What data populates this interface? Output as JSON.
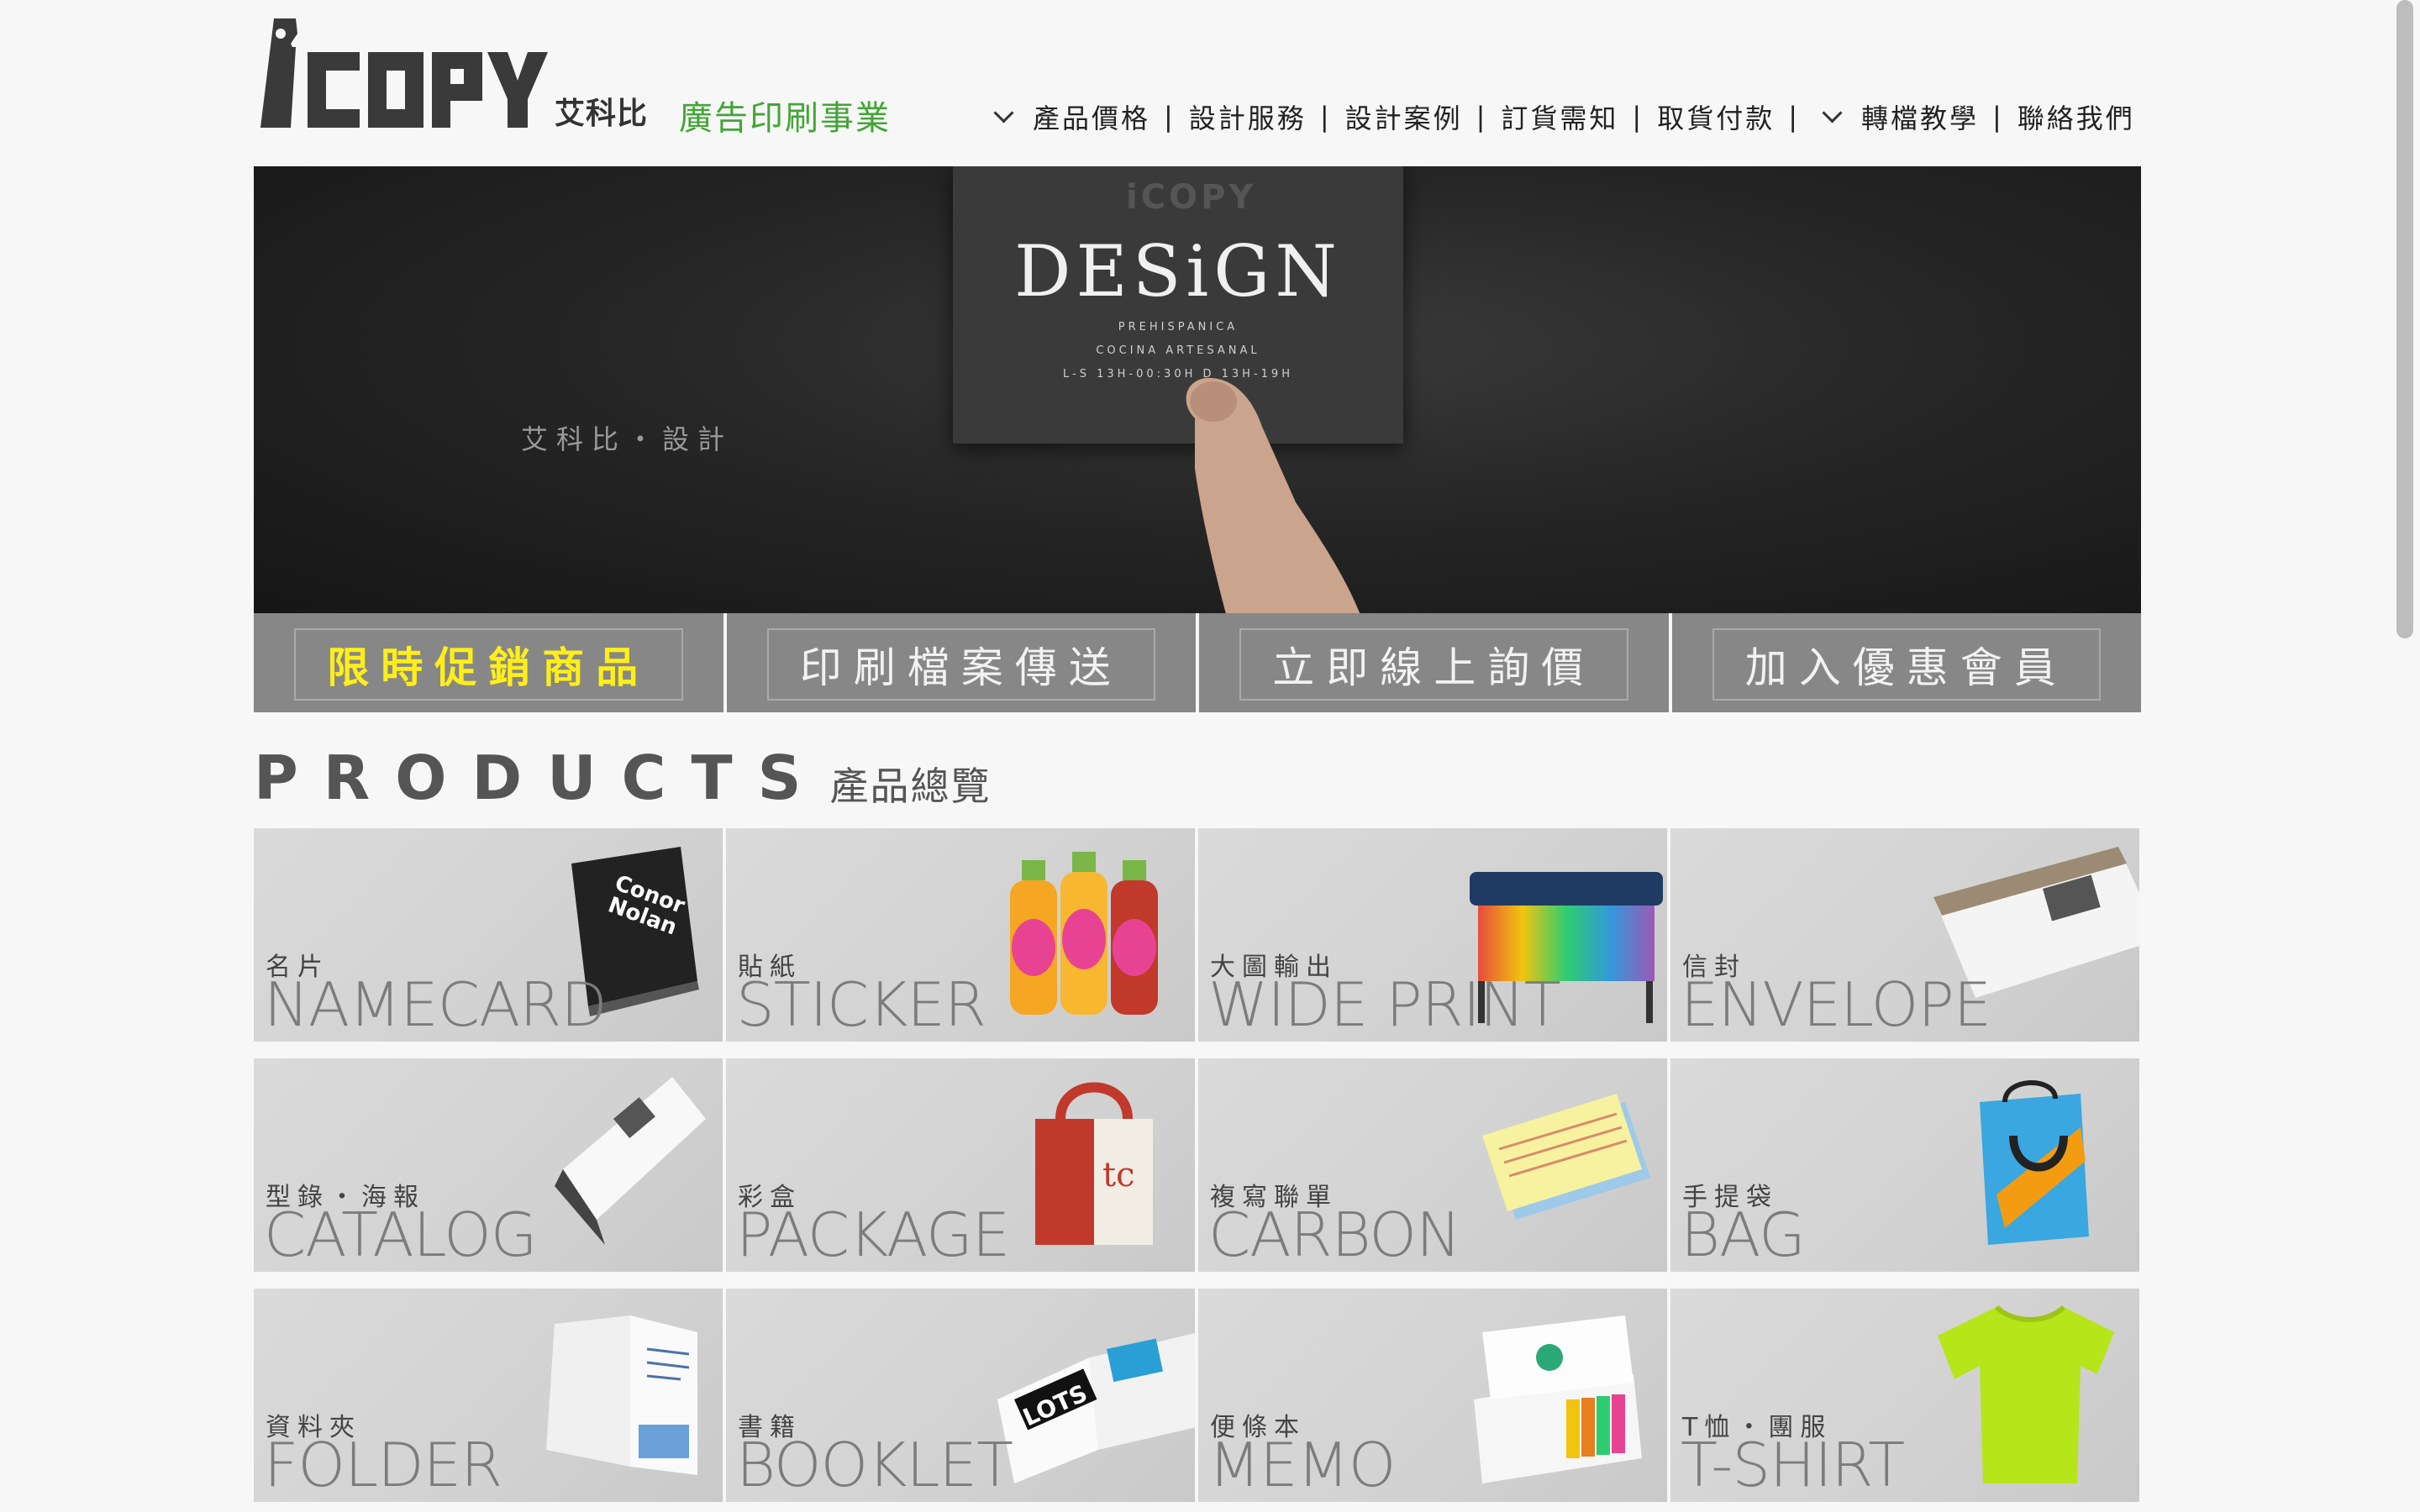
{
  "header": {
    "logo_text": "iCOPY",
    "logo_cn": "艾科比",
    "tagline": "廣告印刷事業"
  },
  "nav": {
    "items": [
      {
        "label": "產品價格",
        "dropdown": true
      },
      {
        "label": "設計服務"
      },
      {
        "label": "設計案例"
      },
      {
        "label": "訂貨需知"
      },
      {
        "label": "取貨付款"
      },
      {
        "label": "轉檔教學",
        "dropdown": true
      },
      {
        "label": "聯絡我們"
      }
    ],
    "separator": "|"
  },
  "banner": {
    "card_logo": "iCOPY",
    "card_title": "DESiGN",
    "card_line1": "PREHISPANICA",
    "card_line2": "COCINA ARTESANAL",
    "card_line3": "L-S 13H-00:30H D 13H-19H",
    "caption": "艾科比・設計"
  },
  "quick_buttons": [
    {
      "label": "限時促銷商品",
      "highlight": true
    },
    {
      "label": "印刷檔案傳送"
    },
    {
      "label": "立即線上詢價"
    },
    {
      "label": "加入優惠會員"
    }
  ],
  "products": {
    "title_en": "PRODUCTS",
    "title_cn": "產品總覽",
    "items": [
      {
        "cn": "名片",
        "en": "NAMECARD",
        "icon": "namecard-icon"
      },
      {
        "cn": "貼紙",
        "en": "STICKER",
        "icon": "bottles-icon"
      },
      {
        "cn": "大圖輸出",
        "en": "WIDE PRINT",
        "icon": "printer-icon"
      },
      {
        "cn": "信封",
        "en": "ENVELOPE",
        "icon": "envelope-icon"
      },
      {
        "cn": "型錄・海報",
        "en": "CATALOG",
        "icon": "catalog-icon"
      },
      {
        "cn": "彩盒",
        "en": "PACKAGE",
        "icon": "package-icon"
      },
      {
        "cn": "複寫聯單",
        "en": "CARBON",
        "icon": "carbon-form-icon"
      },
      {
        "cn": "手提袋",
        "en": "BAG",
        "icon": "bag-icon"
      },
      {
        "cn": "資料夾",
        "en": "FOLDER",
        "icon": "folder-icon"
      },
      {
        "cn": "書籍",
        "en": "BOOKLET",
        "icon": "booklet-icon"
      },
      {
        "cn": "便條本",
        "en": "MEMO",
        "icon": "memo-icon"
      },
      {
        "cn": "T恤・團服",
        "en": "T-SHIRT",
        "icon": "tshirt-icon"
      }
    ]
  },
  "colors": {
    "tagline_green": "#43a536",
    "promo_yellow": "#ffee1a",
    "button_gray": "#878787",
    "tile_gray": "#d4d4d4"
  }
}
